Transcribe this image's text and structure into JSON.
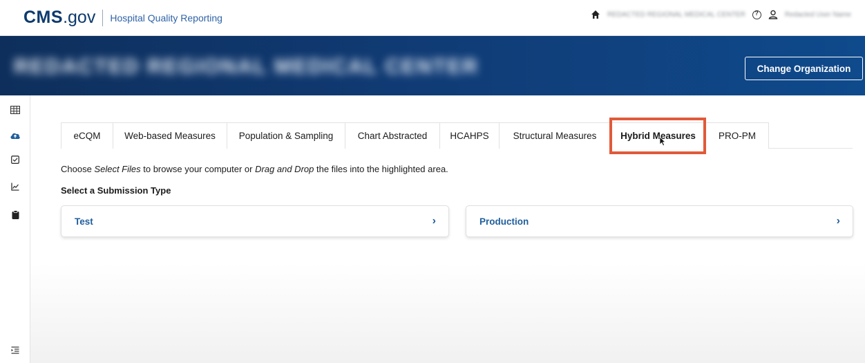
{
  "header": {
    "logo_cms": "CMS",
    "logo_gov": ".gov",
    "app_name": "Hospital Quality Reporting",
    "home_org_blurred": "REDACTED REGIONAL MEDICAL CENTER",
    "user_blurred": "Redacted User Name"
  },
  "banner": {
    "org_name_blurred": "REDACTED REGIONAL MEDICAL CENTER",
    "change_org_label": "Change Organization"
  },
  "sidebar": {
    "icons": [
      "grid-icon",
      "cloud-upload-icon",
      "checkbox-icon",
      "chart-line-icon",
      "clipboard-icon",
      "collapse-menu-icon"
    ],
    "active_index": 1
  },
  "tabs": {
    "items": [
      {
        "label": "eCQM"
      },
      {
        "label": "Web-based Measures"
      },
      {
        "label": "Population & Sampling"
      },
      {
        "label": "Chart Abstracted"
      },
      {
        "label": "HCAHPS"
      },
      {
        "label": "Structural Measures"
      },
      {
        "label": "Hybrid Measures"
      },
      {
        "label": "PRO-PM"
      }
    ],
    "active": "Hybrid Measures"
  },
  "instructions": {
    "part1": "Choose ",
    "select_files": "Select Files",
    "part2": " to browse your computer or ",
    "drag_drop": "Drag and Drop",
    "part3": " the files into the highlighted area."
  },
  "submission": {
    "title": "Select a Submission Type",
    "test_label": "Test",
    "production_label": "Production",
    "chevron": "›"
  },
  "colors": {
    "brand_navy": "#0d3a6e",
    "link_blue": "#1f5e9c",
    "highlight": "#e05a3a"
  }
}
